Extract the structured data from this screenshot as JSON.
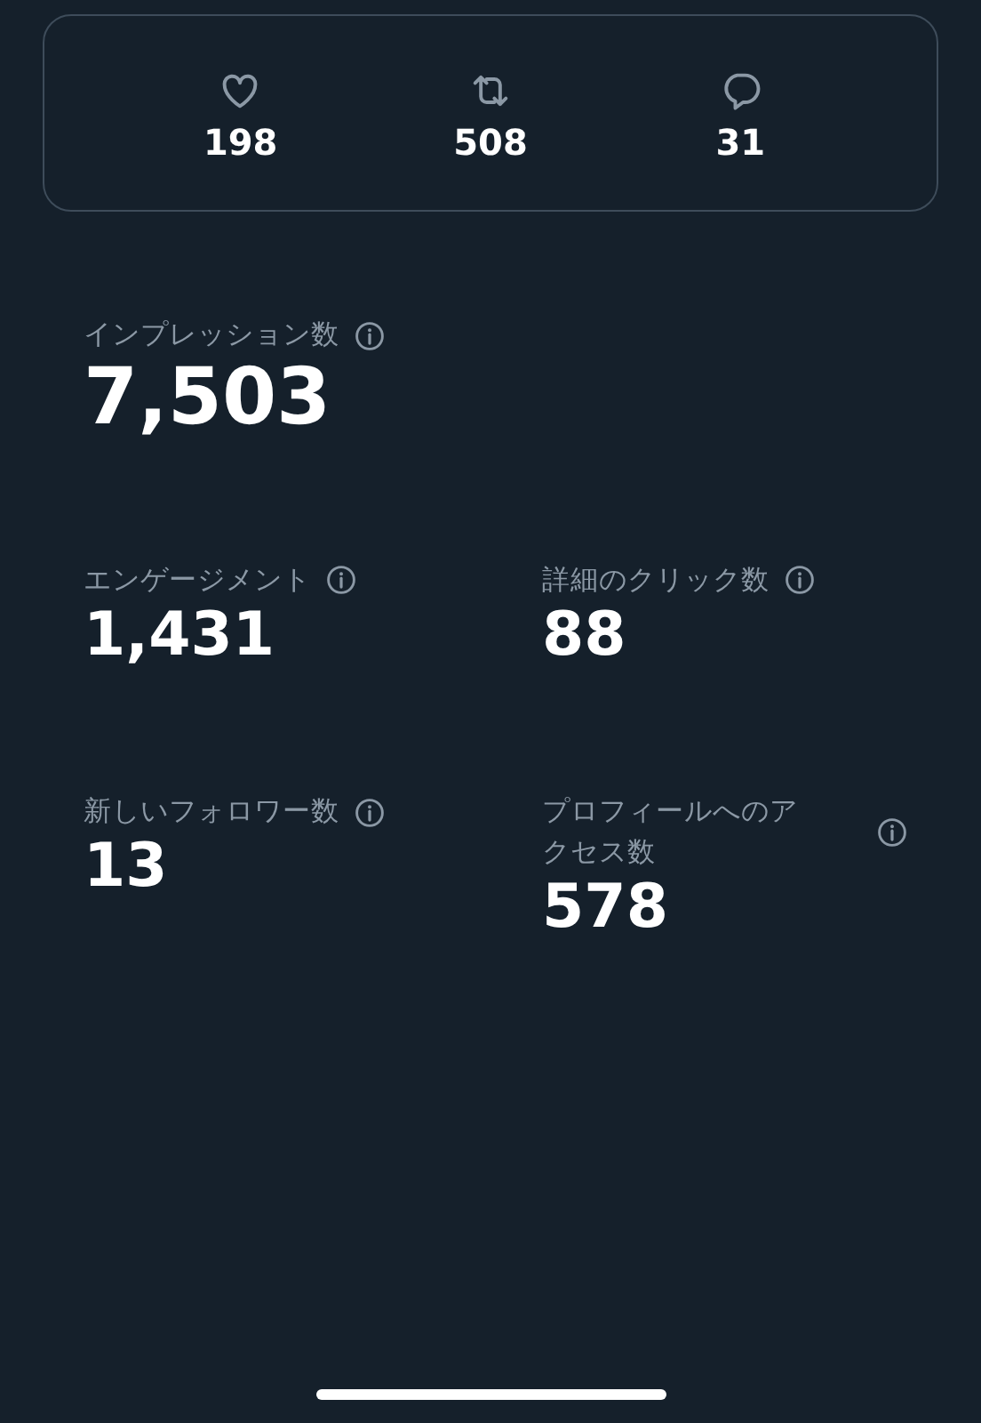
{
  "actions": [
    {
      "kind": "like",
      "count": "198"
    },
    {
      "kind": "repost",
      "count": "508"
    },
    {
      "kind": "reply",
      "count": "31"
    }
  ],
  "metrics": [
    {
      "kind": "hero",
      "label": "インプレッション数",
      "value": "7,503"
    },
    {
      "kind": "stat",
      "label": "エンゲージメント",
      "value": "1,431"
    },
    {
      "kind": "stat",
      "label": "詳細のクリック数",
      "value": "88"
    },
    {
      "kind": "stat",
      "label": "新しいフォロワー数",
      "value": "13"
    },
    {
      "kind": "stat",
      "label": "プロフィールへのアクセス数",
      "value": "578"
    }
  ]
}
